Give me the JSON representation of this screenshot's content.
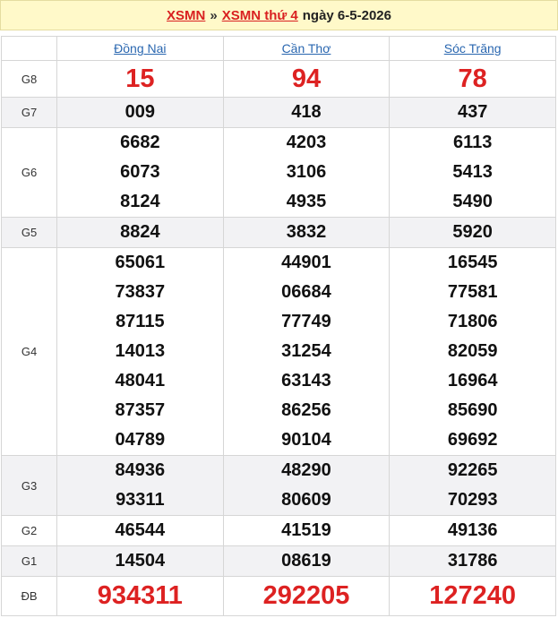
{
  "header": {
    "link1": "XSMN",
    "separator": "»",
    "link2": "XSMN thứ 4",
    "date_text": "ngày 6-5-2026"
  },
  "provinces": [
    "Đồng Nai",
    "Cần Thơ",
    "Sóc Trăng"
  ],
  "prizes": [
    {
      "label": "G8",
      "values": [
        [
          "15"
        ],
        [
          "94"
        ],
        [
          "78"
        ]
      ]
    },
    {
      "label": "G7",
      "values": [
        [
          "009"
        ],
        [
          "418"
        ],
        [
          "437"
        ]
      ]
    },
    {
      "label": "G6",
      "values": [
        [
          "6682",
          "6073",
          "8124"
        ],
        [
          "4203",
          "3106",
          "4935"
        ],
        [
          "6113",
          "5413",
          "5490"
        ]
      ]
    },
    {
      "label": "G5",
      "values": [
        [
          "8824"
        ],
        [
          "3832"
        ],
        [
          "5920"
        ]
      ]
    },
    {
      "label": "G4",
      "values": [
        [
          "65061",
          "73837",
          "87115",
          "14013",
          "48041",
          "87357",
          "04789"
        ],
        [
          "44901",
          "06684",
          "77749",
          "31254",
          "63143",
          "86256",
          "90104"
        ],
        [
          "16545",
          "77581",
          "71806",
          "82059",
          "16964",
          "85690",
          "69692"
        ]
      ]
    },
    {
      "label": "G3",
      "values": [
        [
          "84936",
          "93311"
        ],
        [
          "48290",
          "80609"
        ],
        [
          "92265",
          "70293"
        ]
      ]
    },
    {
      "label": "G2",
      "values": [
        [
          "46544"
        ],
        [
          "41519"
        ],
        [
          "49136"
        ]
      ]
    },
    {
      "label": "G1",
      "values": [
        [
          "14504"
        ],
        [
          "08619"
        ],
        [
          "31786"
        ]
      ]
    },
    {
      "label": "ĐB",
      "values": [
        [
          "934311"
        ],
        [
          "292205"
        ],
        [
          "127240"
        ]
      ]
    }
  ],
  "colors": {
    "accent_red": "#dd2222",
    "link_blue": "#2a67b0",
    "header_bg": "#fff9c9",
    "shade_row": "#f2f2f4"
  }
}
